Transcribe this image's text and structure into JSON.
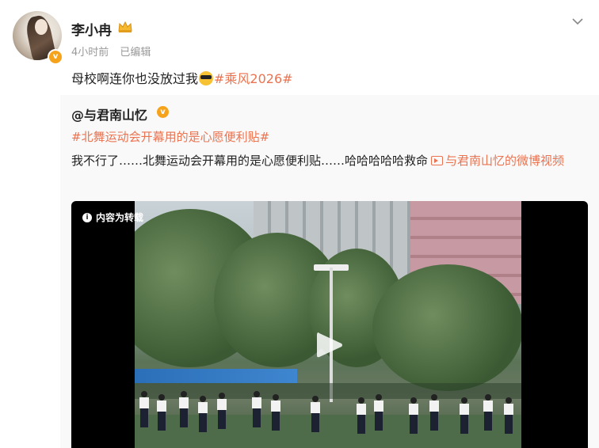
{
  "post": {
    "author": "李小冉",
    "time": "4小时前",
    "edited": "已编辑",
    "text_before": "母校啊连你也没放过我",
    "topic": "#乘风2026#",
    "emoji": "cool-emoji"
  },
  "repost": {
    "author": "@与君南山忆",
    "topic": "#北舞运动会开幕用的是心愿便利贴#",
    "text": "我不行了……北舞运动会开幕用的是心愿便利贴……哈哈哈哈哈救命",
    "video_link": "与君南山忆的微博视频",
    "video_notice": "内容为转载"
  },
  "colors": {
    "accent": "#eb7350",
    "verified": "#f7a21b"
  }
}
